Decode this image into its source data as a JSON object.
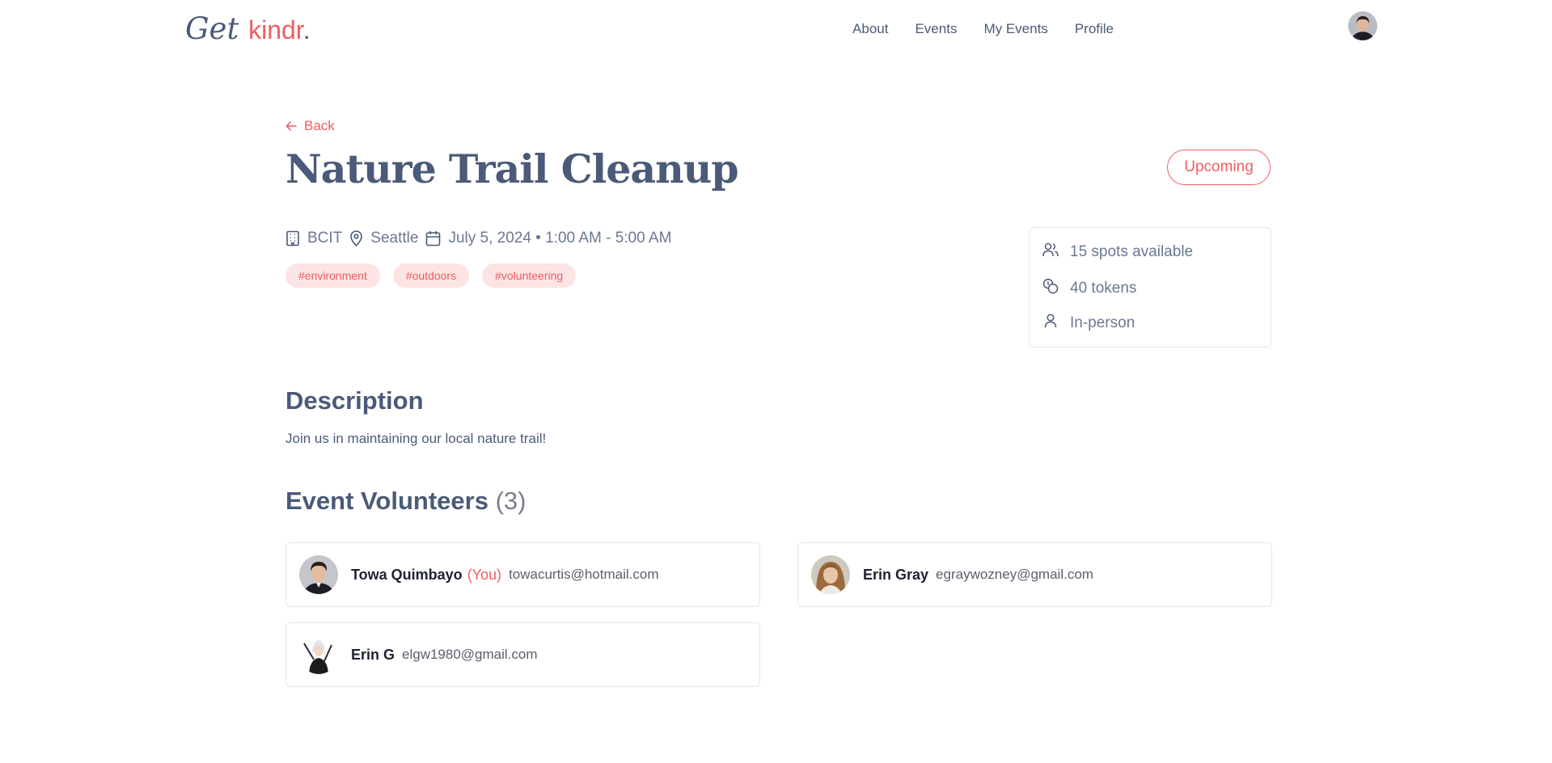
{
  "header": {
    "logo_part1": "Get",
    "logo_part2": "kindr",
    "logo_dot": ".",
    "nav": [
      "About",
      "Events",
      "My Events",
      "Profile"
    ]
  },
  "event": {
    "back_label": "Back",
    "title": "Nature Trail Cleanup",
    "status": "Upcoming",
    "organization": "BCIT",
    "location": "Seattle",
    "datetime": "July 5, 2024 • 1:00 AM - 5:00 AM",
    "tags": [
      "#environment",
      "#outdoors",
      "#volunteering"
    ],
    "spots": "15 spots available",
    "tokens": "40 tokens",
    "mode": "In-person",
    "description_heading": "Description",
    "description": "Join us in maintaining our local nature trail!",
    "volunteers_heading": "Event Volunteers",
    "volunteers_count": "(3)"
  },
  "volunteers": [
    {
      "name": "Towa Quimbayo",
      "you": "(You)",
      "email": "towacurtis@hotmail.com"
    },
    {
      "name": "Erin Gray",
      "you": "",
      "email": "egraywozney@gmail.com"
    },
    {
      "name": "Erin G",
      "you": "",
      "email": "elgw1980@gmail.com"
    }
  ],
  "colors": {
    "accent": "#ef5d60",
    "heading": "#4a5a78",
    "tag_bg": "#fde4e4",
    "border": "#e3e6ec"
  }
}
